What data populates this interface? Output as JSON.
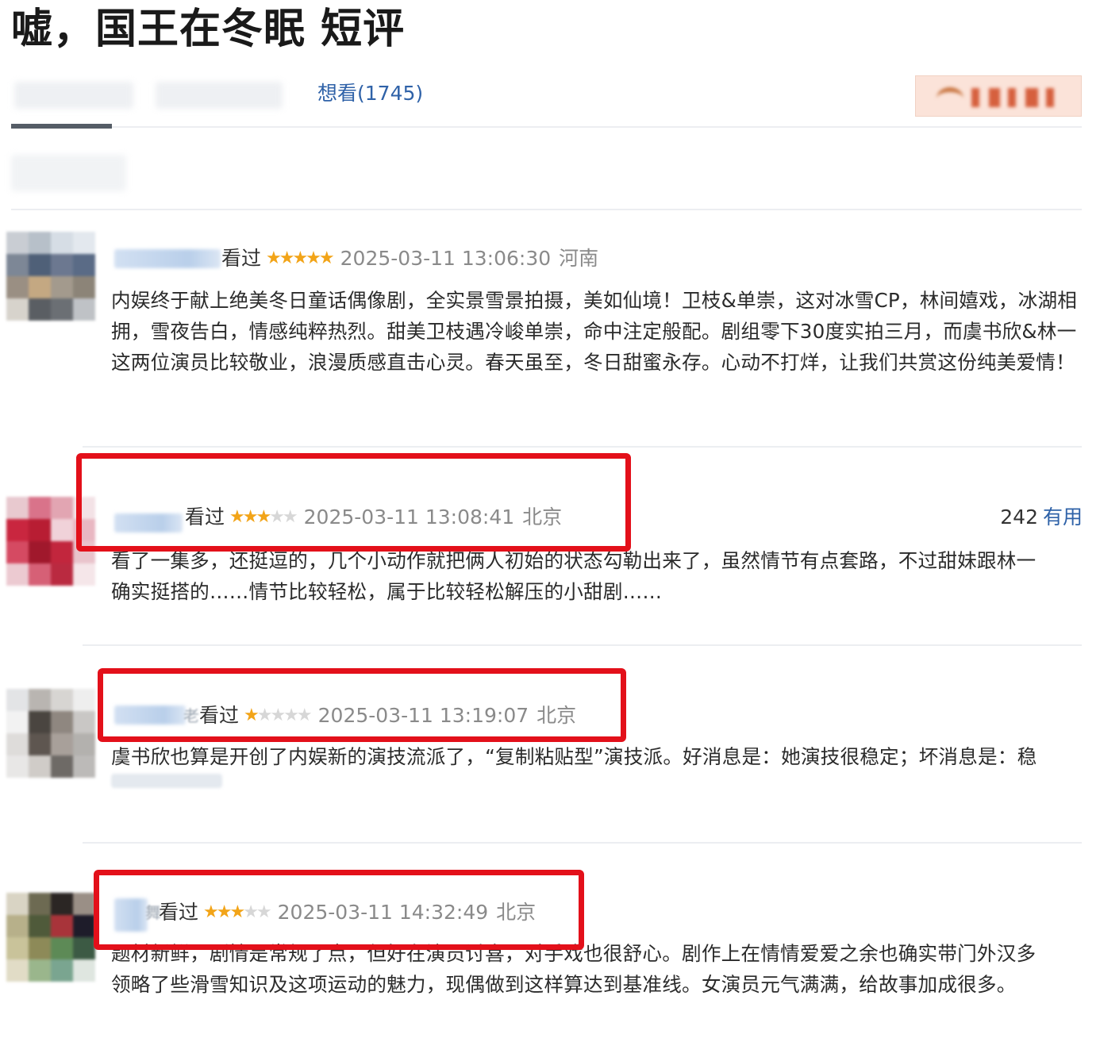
{
  "page": {
    "title": "嘘，国王在冬眠 短评",
    "tabs": {
      "wish_label": "想看(1745)"
    }
  },
  "colors": {
    "accent_link": "#2f62a8",
    "star": "#f2a418",
    "highlight_box": "#e3101a"
  },
  "reviews": [
    {
      "seen_label": "看过",
      "rating": 5,
      "stars_text": "★★★★★",
      "stars_empty": "",
      "datetime": "2025-03-11 13:06:30",
      "location": "河南",
      "text": "内娱终于献上绝美冬日童话偶像剧，全实景雪景拍摄，美如仙境！卫枝&单崇，这对冰雪CP，林间嬉戏，冰湖相拥，雪夜告白，情感纯粹热烈。甜美卫枝遇冷峻单崇，命中注定般配。剧组零下30度实拍三月，而虞书欣&林一这两位演员比较敬业，浪漫质感直击心灵。春天虽至，冬日甜蜜永存。心动不打烊，让我们共赏这份纯美爱情！"
    },
    {
      "seen_label": "看过",
      "rating": 3,
      "stars_text": "★★★",
      "stars_empty": "★★",
      "datetime": "2025-03-11 13:08:41",
      "location": "北京",
      "useful_count": "242",
      "useful_label": "有用",
      "text_line1": "看了一集多，还挺逗的，几个小动作就把俩人初始的状态勾勒出来了，虽然情节有点套路，不过甜妹跟林一",
      "text_line2": "确实挺搭的……情节比较轻松，属于比较轻松解压的小甜剧……"
    },
    {
      "seen_label": "看过",
      "rating": 1,
      "stars_text": "★",
      "stars_empty": "★★★★",
      "datetime": "2025-03-11 13:19:07",
      "location": "北京",
      "name_tail": "老",
      "text": "虞书欣也算是开创了内娱新的演技流派了，“复制粘贴型”演技派。好消息是：她演技很稳定；坏消息是：稳"
    },
    {
      "seen_label": "看过",
      "rating": 3,
      "stars_text": "★★★",
      "stars_empty": "★★",
      "datetime": "2025-03-11 14:32:49",
      "location": "北京",
      "name_tail": "舞",
      "text_line1": "题材新鲜，剧情是常规了点，但好在演员讨喜，对手戏也很舒心。剧作上在情情爱爱之余也确实带门外汉多",
      "text_line2": "领略了些滑雪知识及这项运动的魅力，现偶做到这样算达到基准线。女演员元气满满，给故事加成很多。"
    }
  ]
}
